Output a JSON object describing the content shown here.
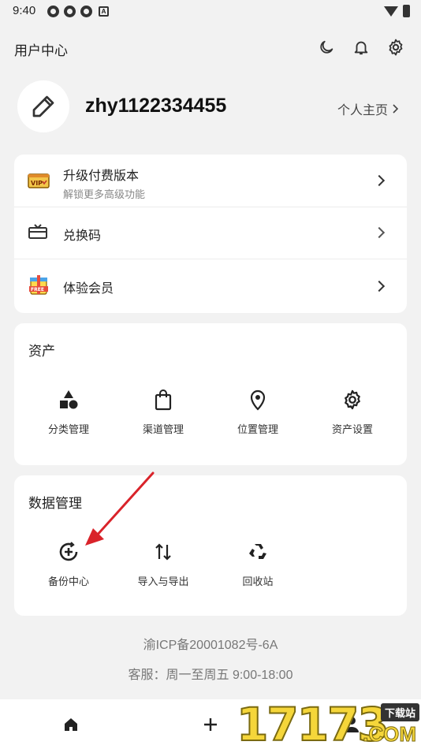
{
  "status_bar": {
    "time": "9:40",
    "badge_letter": "A"
  },
  "header": {
    "title": "用户中心"
  },
  "profile": {
    "username": "zhy1122334455",
    "homepage_link": "个人主页"
  },
  "vip_menu": [
    {
      "label": "升级付费版本",
      "sublabel": "解锁更多高级功能",
      "icon": "vip-ticket-icon",
      "icon_text": "VIP"
    },
    {
      "label": "兑换码",
      "icon": "gift-card-icon"
    },
    {
      "label": "体验会员",
      "icon": "free-gift-icon",
      "icon_text": "FREE"
    }
  ],
  "assets": {
    "title": "资产",
    "items": [
      {
        "label": "分类管理",
        "icon": "shapes-icon"
      },
      {
        "label": "渠道管理",
        "icon": "shopping-bag-icon"
      },
      {
        "label": "位置管理",
        "icon": "location-pin-icon"
      },
      {
        "label": "资产设置",
        "icon": "gear-icon"
      }
    ]
  },
  "data_management": {
    "title": "数据管理",
    "items": [
      {
        "label": "备份中心",
        "icon": "backup-plus-icon"
      },
      {
        "label": "导入与导出",
        "icon": "import-export-icon"
      },
      {
        "label": "回收站",
        "icon": "recycle-icon"
      }
    ]
  },
  "footer": {
    "icp": "渝ICP备20001082号-6A",
    "service": "客服：周一至周五 9:00-18:00"
  },
  "watermark": {
    "digits": "17173",
    "badge": "下载站",
    "domain": ".COM"
  },
  "colors": {
    "accent_arrow": "#d9232a",
    "background": "#f2f2f2",
    "card": "#ffffff"
  }
}
